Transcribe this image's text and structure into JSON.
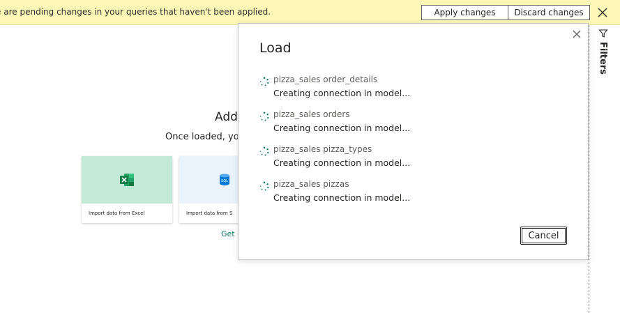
{
  "notice_bar": {
    "message": "ere are pending changes in your queries that haven't been applied.",
    "apply_label": "Apply changes",
    "discard_label": "Discard changes"
  },
  "background": {
    "title": "Add",
    "subtitle": "Once loaded, you",
    "cards": [
      {
        "label": "Import data from Excel",
        "icon": "excel-icon",
        "color": "#c2ead6"
      },
      {
        "label": "Import data from S",
        "icon": "sql-database-icon",
        "color": "#eaf3fc"
      }
    ],
    "link_text": "Get c"
  },
  "filters": {
    "label": "Filters"
  },
  "dialog": {
    "title": "Load",
    "items": [
      {
        "name": "pizza_sales order_details",
        "status": "Creating connection in model..."
      },
      {
        "name": "pizza_sales orders",
        "status": "Creating connection in model..."
      },
      {
        "name": "pizza_sales pizza_types",
        "status": "Creating connection in model..."
      },
      {
        "name": "pizza_sales pizzas",
        "status": "Creating connection in model..."
      }
    ],
    "cancel_label": "Cancel"
  },
  "colors": {
    "notice_bg": "#fcf7b6",
    "accent_teal": "#117865",
    "excel_green": "#107c41",
    "sql_blue": "#0078d4"
  }
}
